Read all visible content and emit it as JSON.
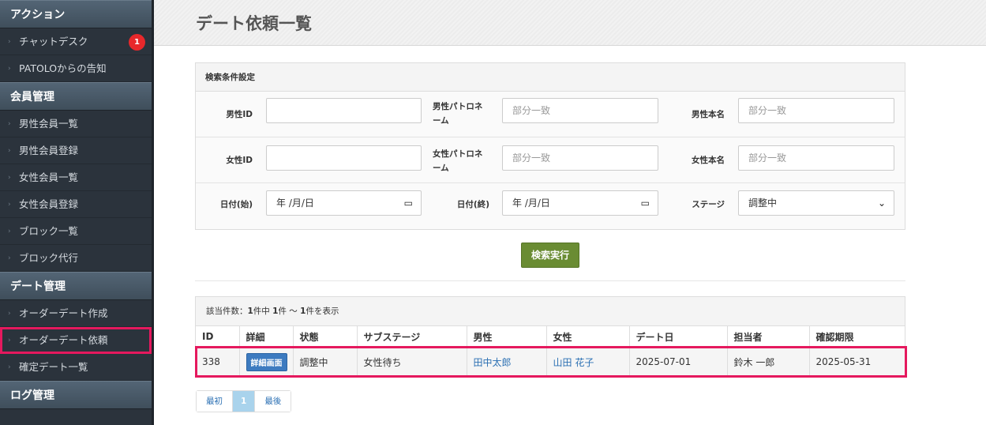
{
  "sidebar": {
    "sections": [
      {
        "title": "アクション",
        "items": [
          {
            "label": "チャットデスク",
            "badge": "1"
          },
          {
            "label": "PATOLOからの告知"
          }
        ]
      },
      {
        "title": "会員管理",
        "items": [
          {
            "label": "男性会員一覧"
          },
          {
            "label": "男性会員登録"
          },
          {
            "label": "女性会員一覧"
          },
          {
            "label": "女性会員登録"
          },
          {
            "label": "ブロック一覧"
          },
          {
            "label": "ブロック代行"
          }
        ]
      },
      {
        "title": "デート管理",
        "items": [
          {
            "label": "オーダーデート作成"
          },
          {
            "label": "オーダーデート依頼",
            "active": true
          },
          {
            "label": "確定デート一覧"
          }
        ]
      },
      {
        "title": "ログ管理",
        "items": []
      }
    ]
  },
  "page": {
    "title": "デート依頼一覧"
  },
  "search": {
    "heading": "検索条件設定",
    "male_id_label": "男性ID",
    "male_patron_label": "男性パトロネーム",
    "male_patron_placeholder": "部分一致",
    "male_realname_label": "男性本名",
    "male_realname_placeholder": "部分一致",
    "female_id_label": "女性ID",
    "female_patron_label": "女性パトロネーム",
    "female_patron_placeholder": "部分一致",
    "female_realname_label": "女性本名",
    "female_realname_placeholder": "部分一致",
    "date_start_label": "日付(始)",
    "date_start_value": "年 /月/日",
    "date_end_label": "日付(終)",
    "date_end_value": "年 /月/日",
    "stage_label": "ステージ",
    "stage_value": "調整中",
    "submit_label": "検索実行"
  },
  "results": {
    "summary_prefix": "該当件数：",
    "summary_total": "1",
    "summary_mid1": "件中 ",
    "summary_from": "1",
    "summary_mid2": "件 ～ ",
    "summary_to": "1",
    "summary_suffix": "件を表示",
    "columns": [
      "ID",
      "詳細",
      "状態",
      "サブステージ",
      "男性",
      "女性",
      "デート日",
      "担当者",
      "確認期限"
    ],
    "rows": [
      {
        "id": "338",
        "detail": "詳細画面",
        "status": "調整中",
        "substage": "女性待ち",
        "male": "田中太郎",
        "female": "山田 花子",
        "date": "2025-07-01",
        "staff": "鈴木 一郎",
        "deadline": "2025-05-31"
      }
    ]
  },
  "pager": {
    "first": "最初",
    "current": "1",
    "last": "最後"
  },
  "colors": {
    "accent_highlight": "#e5195e",
    "primary_button": "#6a8c33",
    "badge": "#e8282b",
    "link": "#2a6fb3"
  }
}
